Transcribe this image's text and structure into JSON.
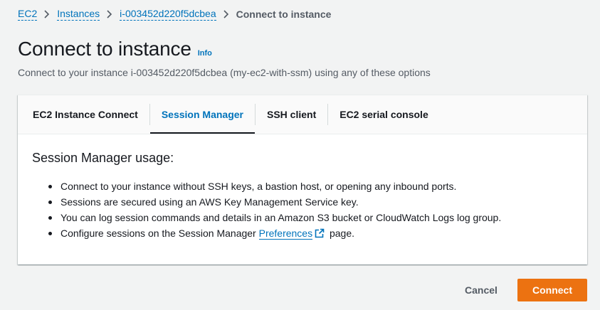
{
  "breadcrumb": {
    "items": [
      {
        "label": "EC2"
      },
      {
        "label": "Instances"
      },
      {
        "label": "i-003452d220f5dcbea"
      }
    ],
    "current": "Connect to instance"
  },
  "header": {
    "title": "Connect to instance",
    "info_label": "Info",
    "subtitle": "Connect to your instance i-003452d220f5dcbea (my-ec2-with-ssm) using any of these options"
  },
  "tabs": [
    {
      "label": "EC2 Instance Connect",
      "active": false
    },
    {
      "label": "Session Manager",
      "active": true
    },
    {
      "label": "SSH client",
      "active": false
    },
    {
      "label": "EC2 serial console",
      "active": false
    }
  ],
  "session_manager": {
    "heading": "Session Manager usage:",
    "bullets": [
      "Connect to your instance without SSH keys, a bastion host, or opening any inbound ports.",
      "Sessions are secured using an AWS Key Management Service key.",
      "You can log session commands and details in an Amazon S3 bucket or CloudWatch Logs log group."
    ],
    "last_bullet": {
      "prefix": "Configure sessions on the Session Manager ",
      "link": "Preferences",
      "suffix": " page."
    }
  },
  "footer": {
    "cancel_label": "Cancel",
    "connect_label": "Connect"
  },
  "colors": {
    "accent": "#0073bb",
    "primary_button": "#ec7211",
    "background": "#f2f3f3"
  },
  "icons": {
    "breadcrumb_separator": "chevron-right-icon",
    "preferences_link": "external-link-icon"
  }
}
